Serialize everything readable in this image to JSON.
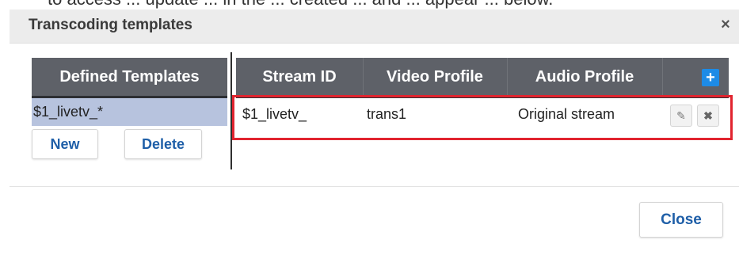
{
  "background_text": "to access ... update ... in the ... created ... and ... appear ... below.",
  "dialog": {
    "title": "Transcoding templates",
    "close_icon": "×"
  },
  "templates_panel": {
    "header": "Defined Templates",
    "items": [
      "$1_livetv_*"
    ],
    "new_label": "New",
    "delete_label": "Delete"
  },
  "streams_table": {
    "columns": [
      "Stream ID",
      "Video Profile",
      "Audio Profile"
    ],
    "add_icon": "+",
    "rows": [
      {
        "stream_id": "$1_livetv_",
        "video_profile": "trans1",
        "audio_profile": "Original stream"
      }
    ],
    "edit_icon": "✎",
    "delete_icon": "✖"
  },
  "footer": {
    "close_label": "Close"
  },
  "colors": {
    "header_bg": "#5e6168",
    "selected_item_bg": "#b7c3de",
    "highlight": "#e1242f",
    "accent": "#1d8be6",
    "link_text": "#1f5fa8"
  }
}
